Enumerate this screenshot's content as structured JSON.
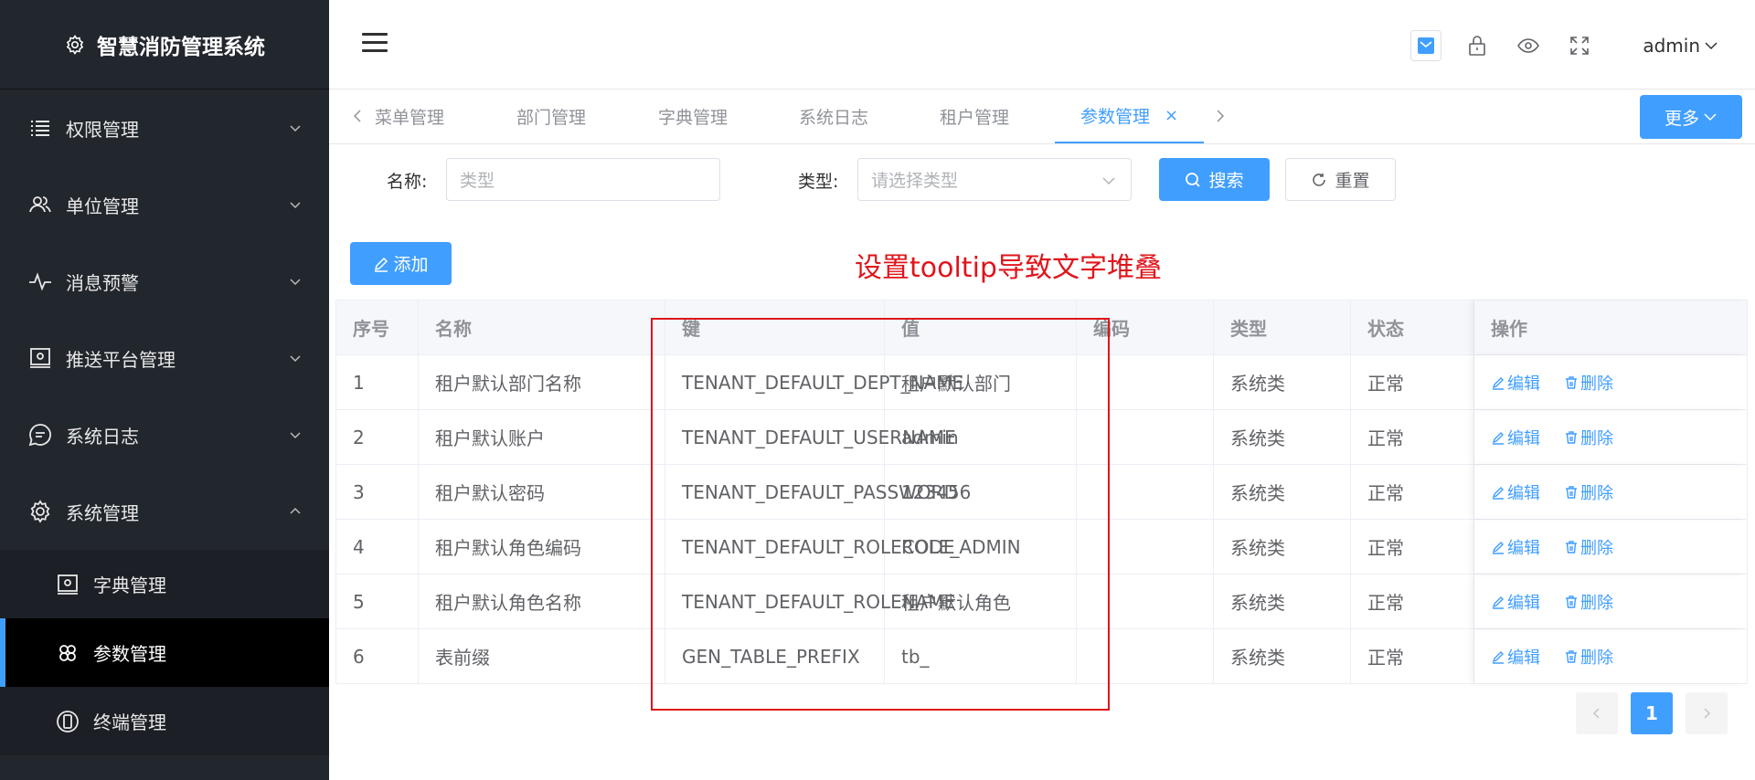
{
  "app": {
    "title": "智慧消防管理系统"
  },
  "sidebar": {
    "items": [
      {
        "label": "权限管理",
        "icon": "list-icon",
        "expanded": false
      },
      {
        "label": "单位管理",
        "icon": "users-icon",
        "expanded": false
      },
      {
        "label": "消息预警",
        "icon": "pulse-icon",
        "expanded": false
      },
      {
        "label": "推送平台管理",
        "icon": "monitor-icon",
        "expanded": false
      },
      {
        "label": "系统日志",
        "icon": "chat-icon",
        "expanded": false
      },
      {
        "label": "系统管理",
        "icon": "gear-icon",
        "expanded": true
      }
    ],
    "sub_items": [
      {
        "label": "字典管理",
        "icon": "monitor-icon",
        "active": false
      },
      {
        "label": "参数管理",
        "icon": "flower-icon",
        "active": true
      },
      {
        "label": "终端管理",
        "icon": "phone-icon",
        "active": false
      }
    ]
  },
  "header": {
    "user": "admin"
  },
  "tabs": {
    "items": [
      "菜单管理",
      "部门管理",
      "字典管理",
      "系统日志",
      "租户管理",
      "参数管理"
    ],
    "active": "参数管理",
    "close_symbol": "×",
    "more_label": "更多"
  },
  "search": {
    "name_label": "名称:",
    "name_placeholder": "类型",
    "type_label": "类型:",
    "type_placeholder": "请选择类型",
    "search_label": "搜索",
    "reset_label": "重置"
  },
  "toolbar": {
    "add_label": "添加"
  },
  "annotation": "设置tooltip导致文字堆叠",
  "table": {
    "headers": [
      "序号",
      "名称",
      "键",
      "值",
      "编码",
      "类型",
      "状态",
      "操作"
    ],
    "edit_label": "编辑",
    "delete_label": "删除",
    "rows": [
      {
        "no": "1",
        "name": "租户默认部门名称",
        "key": "TENANT_DEFAULT_DEPT_NAME",
        "value": "租户默认部门",
        "code": "",
        "type": "系统类",
        "status": "正常"
      },
      {
        "no": "2",
        "name": "租户默认账户",
        "key": "TENANT_DEFAULT_USERNAME",
        "value": "admin",
        "code": "",
        "type": "系统类",
        "status": "正常"
      },
      {
        "no": "3",
        "name": "租户默认密码",
        "key": "TENANT_DEFAULT_PASSWORD",
        "value": "123456",
        "code": "",
        "type": "系统类",
        "status": "正常"
      },
      {
        "no": "4",
        "name": "租户默认角色编码",
        "key": "TENANT_DEFAULT_ROLECODE",
        "value": "ROLE_ADMIN",
        "code": "",
        "type": "系统类",
        "status": "正常"
      },
      {
        "no": "5",
        "name": "租户默认角色名称",
        "key": "TENANT_DEFAULT_ROLENAME",
        "value": "租户默认角色",
        "code": "",
        "type": "系统类",
        "status": "正常"
      },
      {
        "no": "6",
        "name": "表前缀",
        "key": "GEN_TABLE_PREFIX",
        "value": "tb_",
        "code": "",
        "type": "系统类",
        "status": "正常"
      }
    ]
  },
  "pagination": {
    "current": "1"
  },
  "colors": {
    "primary": "#409eff",
    "sidebar_bg": "#22262d",
    "annotation_red": "#e0141b"
  }
}
